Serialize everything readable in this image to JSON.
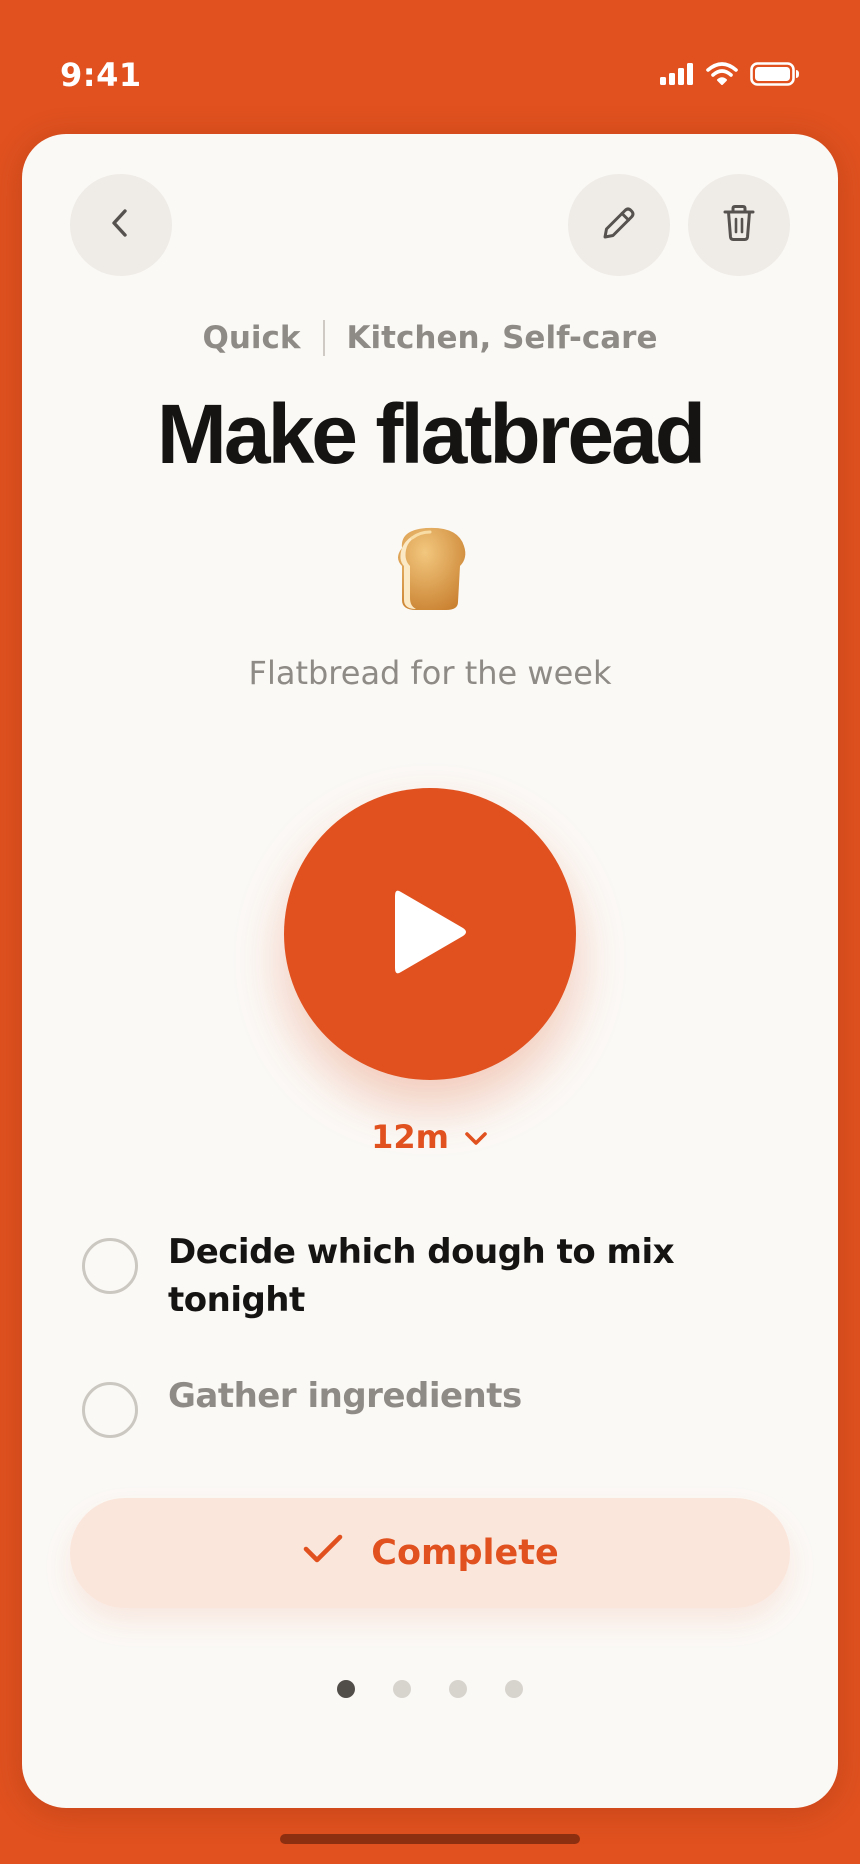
{
  "status_bar": {
    "time": "9:41"
  },
  "nav": {
    "back_icon": "chevron-left-icon",
    "edit_icon": "pencil-icon",
    "delete_icon": "trash-icon"
  },
  "task": {
    "duration_type": "Quick",
    "categories": "Kitchen, Self-care",
    "title": "Make flatbread",
    "emoji": "bread",
    "description": "Flatbread for the week"
  },
  "timer": {
    "play_icon": "play-icon",
    "duration": "12m",
    "dropdown_icon": "chevron-down-icon"
  },
  "subtasks": [
    {
      "label": "Decide which dough to mix tonight",
      "done": false
    },
    {
      "label": "Gather ingredients",
      "done": false
    }
  ],
  "complete_button": {
    "label": "Complete",
    "icon": "checkmark-icon"
  },
  "pagination": {
    "total": 4,
    "current": 1
  },
  "colors": {
    "accent": "#E0511F",
    "card_background": "#FBF9F6",
    "muted_text": "#8E8A85",
    "primary_text": "#151412"
  }
}
